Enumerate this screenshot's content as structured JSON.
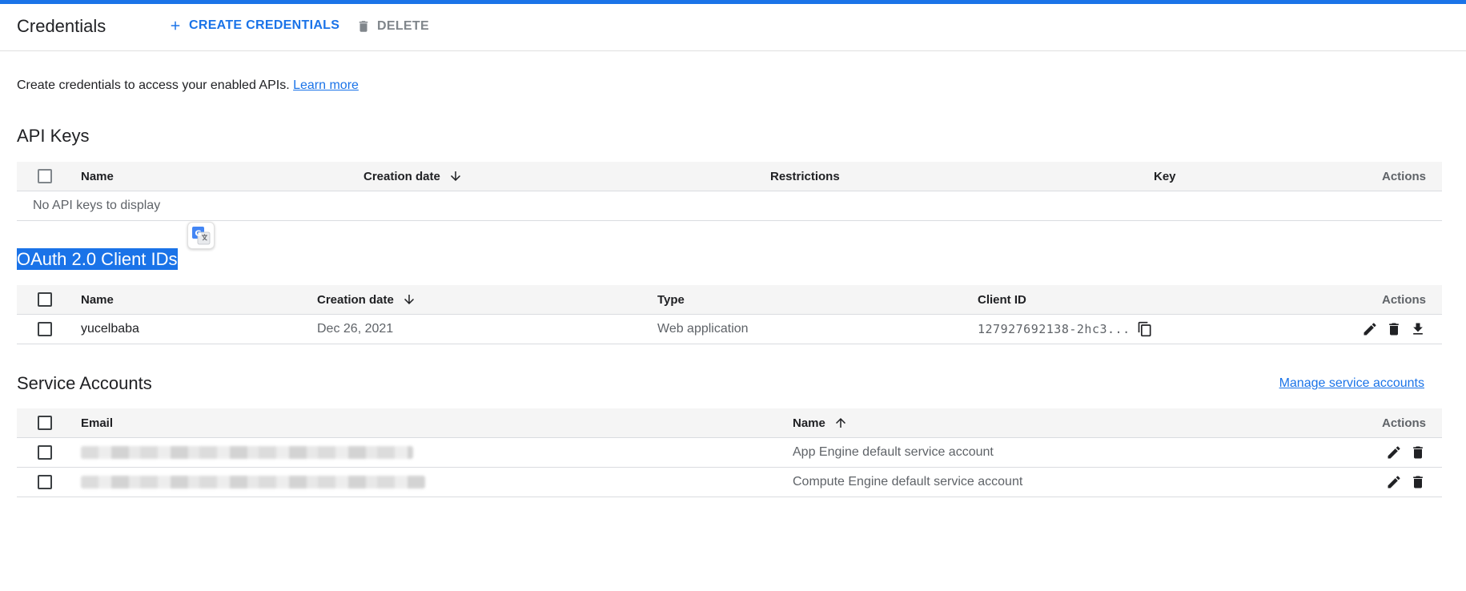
{
  "header": {
    "title": "Credentials",
    "create_label": "CREATE CREDENTIALS",
    "delete_label": "DELETE"
  },
  "intro": {
    "text": "Create credentials to access your enabled APIs.",
    "learn_more": "Learn more"
  },
  "api_keys": {
    "title": "API Keys",
    "columns": [
      "Name",
      "Creation date",
      "Restrictions",
      "Key",
      "Actions"
    ],
    "empty_text": "No API keys to display"
  },
  "oauth": {
    "title": "OAuth 2.0 Client IDs",
    "columns": [
      "Name",
      "Creation date",
      "Type",
      "Client ID",
      "Actions"
    ],
    "rows": [
      {
        "name": "yucelbaba",
        "created": "Dec 26, 2021",
        "type": "Web application",
        "client_id": "127927692138-2hc3..."
      }
    ]
  },
  "service_accounts": {
    "title": "Service Accounts",
    "manage_link": "Manage service accounts",
    "columns": [
      "Email",
      "Name",
      "Actions"
    ],
    "rows": [
      {
        "name": "App Engine default service account"
      },
      {
        "name": "Compute Engine default service account"
      }
    ]
  },
  "colors": {
    "accent": "#1a73e8",
    "selection": "#1a73e8",
    "header_bg": "#f5f5f5"
  }
}
